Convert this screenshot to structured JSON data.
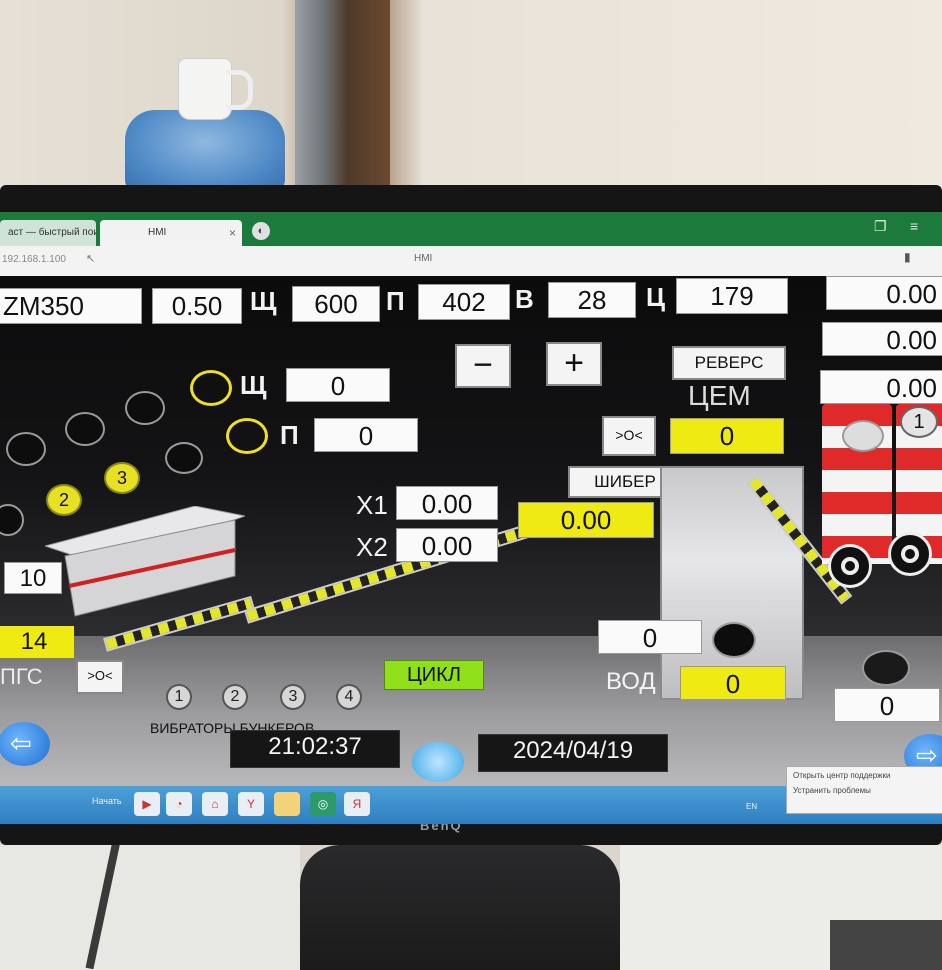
{
  "browser": {
    "tab1_label": "аст — быстрый поис",
    "tab2_label": "HMI",
    "page_title": "HMI",
    "address": "192.168.1.100"
  },
  "header": {
    "recipe": "ZM350",
    "shch_ratio": "0.50",
    "shch_label": "Щ",
    "p_value": "600",
    "p_label": "П",
    "v_value": "402",
    "v_label": "В",
    "ts_value": "28",
    "ts_label": "Ц",
    "last_value": "179"
  },
  "controls": {
    "minus": "−",
    "plus": "+",
    "reverse": "РЕВЕРС",
    "cem_label": "ЦЕМ",
    "cem_value": "0",
    "toggle": ">O<",
    "shiber": "ШИБЕР"
  },
  "aggregates": {
    "shch_label": "Щ",
    "shch_value": "0",
    "p_label": "П",
    "p_value": "0",
    "bin2": "2",
    "bin3": "3",
    "bin_weight": "10",
    "pgs_value": "14",
    "pgs_label": "ПГС",
    "pgs_toggle": ">O<"
  },
  "conveyor": {
    "x1_label": "X1",
    "x1_value": "0.00",
    "x2_label": "X2",
    "x2_value": "0.00",
    "belt_value": "0.00",
    "cycle": "ЦИКЛ"
  },
  "silos": {
    "s1": "0.00",
    "s2": "0.00",
    "s3": "0.00",
    "silo_num": "1",
    "bottom_value": "0"
  },
  "water": {
    "value_top": "0",
    "label": "ВОД",
    "value": "0"
  },
  "vibrators": {
    "items": [
      "1",
      "2",
      "3",
      "4"
    ],
    "label": "ВИБРАТОРЫ БУНКЕРОВ"
  },
  "status": {
    "time": "21:02:37",
    "date": "2024/04/19"
  },
  "taskbar": {
    "start_label": "Начать",
    "lang": "EN",
    "menu1": "Открыть центр поддержки",
    "menu2": "Устранить проблемы"
  },
  "monitor": {
    "brand": "BenQ"
  },
  "colors": {
    "field_yellow": "#f0ea13",
    "tab_green": "#1b7a3c",
    "taskbar_blue": "#2d7fc0"
  }
}
